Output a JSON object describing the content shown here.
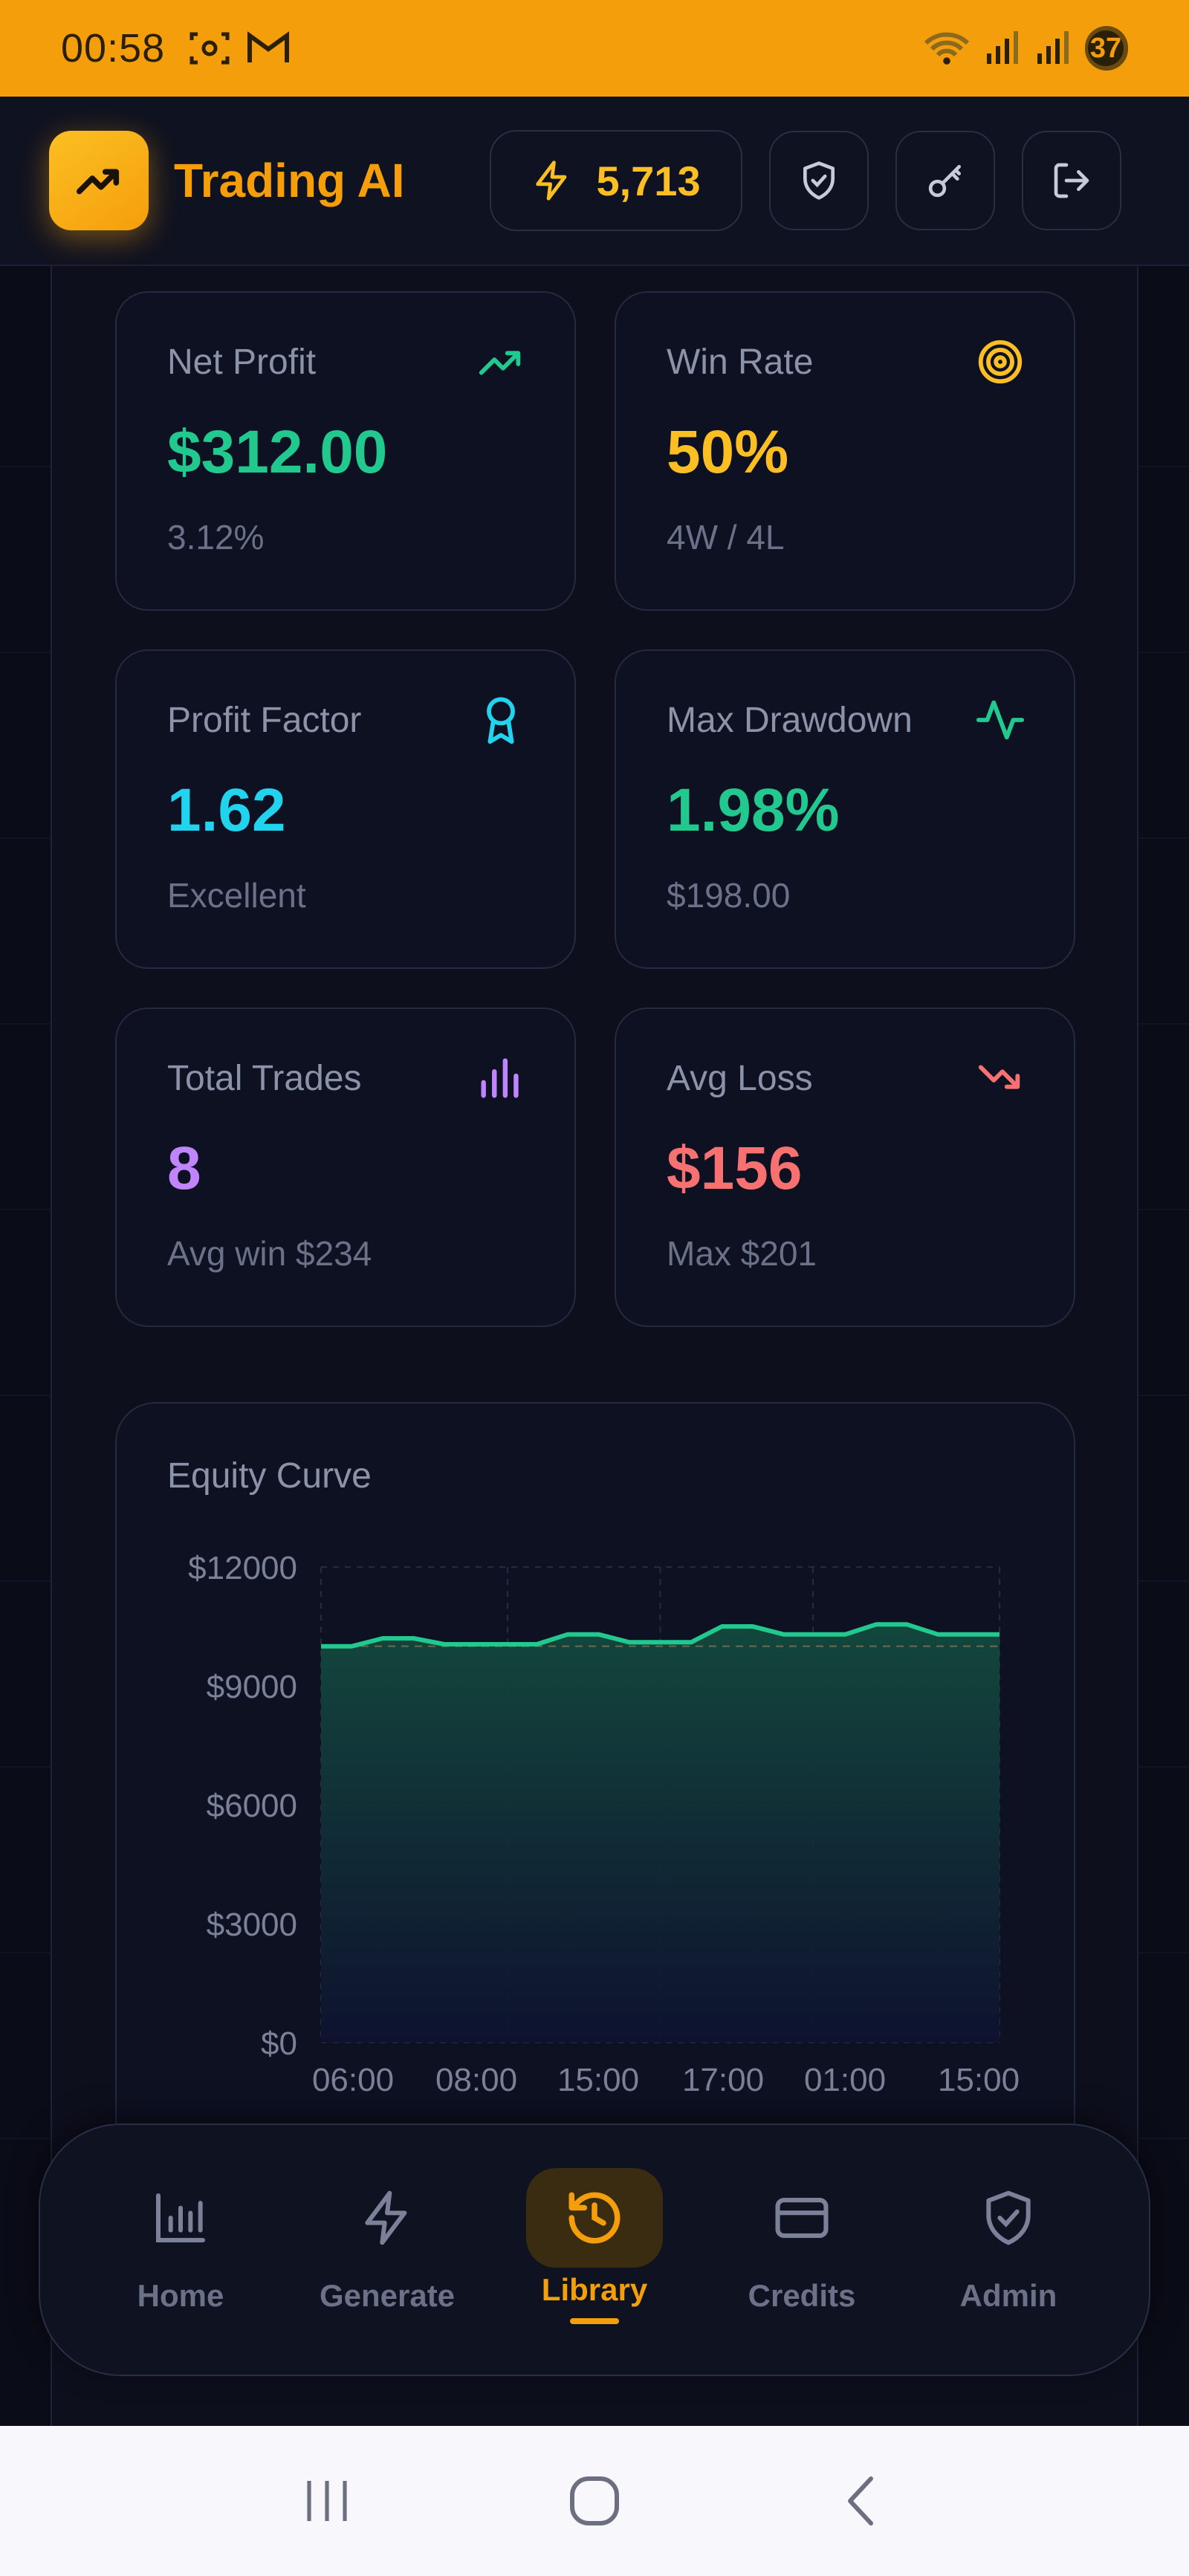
{
  "status_bar": {
    "time": "00:58",
    "battery": "37"
  },
  "header": {
    "title": "Trading AI",
    "credits": "5,713"
  },
  "stats": [
    {
      "label": "Net Profit",
      "value": "$312.00",
      "sub": "3.12%",
      "color": "#22c98f",
      "icon": "trending-up-icon"
    },
    {
      "label": "Win Rate",
      "value": "50%",
      "sub": "4W / 4L",
      "color": "#fbbf24",
      "icon": "target-icon"
    },
    {
      "label": "Profit Factor",
      "value": "1.62",
      "sub": "Excellent",
      "color": "#22d3ee",
      "icon": "award-icon"
    },
    {
      "label": "Max Drawdown",
      "value": "1.98%",
      "sub": "$198.00",
      "color": "#22c98f",
      "icon": "activity-icon"
    },
    {
      "label": "Total Trades",
      "value": "8",
      "sub": "Avg win $234",
      "color": "#c084fc",
      "icon": "bar-chart-icon"
    },
    {
      "label": "Avg Loss",
      "value": "$156",
      "sub": "Max $201",
      "color": "#f87171",
      "icon": "trending-down-icon"
    }
  ],
  "equity": {
    "title": "Equity Curve",
    "chart_data": {
      "type": "area",
      "title": "Equity Curve",
      "x_ticks": [
        "06:00",
        "08:00",
        "15:00",
        "17:00",
        "01:00",
        "15:00"
      ],
      "y_ticks": [
        "$12000",
        "$9000",
        "$6000",
        "$3000",
        "$0"
      ],
      "ylim": [
        0,
        12000
      ],
      "baseline": 10000,
      "series": [
        {
          "values": [
            10000,
            10000,
            10200,
            10200,
            10050,
            10050,
            10050,
            10050,
            10300,
            10300,
            10100,
            10100,
            10100,
            10500,
            10500,
            10300,
            10300,
            10300,
            10550,
            10550,
            10300,
            10300,
            10300
          ]
        }
      ],
      "grid": true,
      "line_color": "#22c98f"
    }
  },
  "nav": {
    "items": [
      {
        "label": "Home",
        "icon": "home-chart-icon",
        "active": false
      },
      {
        "label": "Generate",
        "icon": "bolt-icon",
        "active": false
      },
      {
        "label": "Library",
        "icon": "history-icon",
        "active": true
      },
      {
        "label": "Credits",
        "icon": "credit-card-icon",
        "active": false
      },
      {
        "label": "Admin",
        "icon": "shield-check-icon",
        "active": false
      }
    ]
  }
}
